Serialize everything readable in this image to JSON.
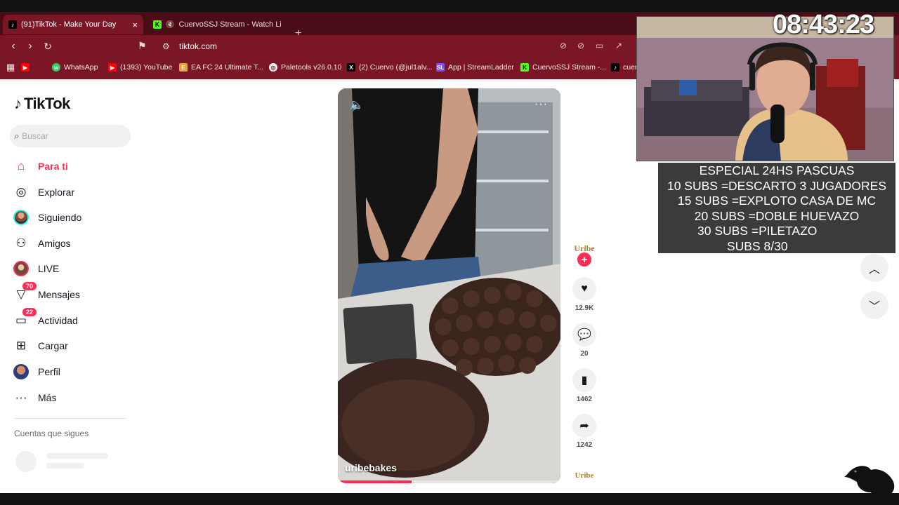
{
  "browser": {
    "tabs": [
      {
        "label": "(91)TikTok - Make Your Day",
        "active": true,
        "icon": "tiktok-icon"
      },
      {
        "label": "CuervoSSJ Stream - Watch Live o",
        "active": false,
        "icon": "kick-icon"
      }
    ],
    "new_tab": "+",
    "url": "tiktok.com",
    "bookmarks": [
      {
        "label": "WhatsApp",
        "icon": "whatsapp-icon",
        "color": "#25d366"
      },
      {
        "label": "(1393) YouTube",
        "icon": "youtube-icon",
        "color": "#ff0000"
      },
      {
        "label": "EA FC 24 Ultimate T...",
        "icon": "ea-icon",
        "color": "#e9a23b"
      },
      {
        "label": "Paletools v26.0.10",
        "icon": "globe-icon",
        "color": "#ffffff"
      },
      {
        "label": "(2) Cuervo (@jul1alv...",
        "icon": "x-icon",
        "color": "#000000"
      },
      {
        "label": "App | StreamLadder",
        "icon": "streamladder-icon",
        "color": "#7c4dff"
      },
      {
        "label": "CuervoSSJ Stream -...",
        "icon": "kick-icon",
        "color": "#53fc18"
      },
      {
        "label": "cuer",
        "icon": "tiktok-icon",
        "color": "#000000"
      }
    ]
  },
  "tiktok": {
    "logo_text": "TikTok",
    "search_placeholder": "Buscar",
    "nav": [
      {
        "label": "Para ti",
        "icon": "home-icon",
        "active": true
      },
      {
        "label": "Explorar",
        "icon": "compass-icon"
      },
      {
        "label": "Siguiendo",
        "icon": "following-avatar-icon"
      },
      {
        "label": "Amigos",
        "icon": "friends-icon"
      },
      {
        "label": "LIVE",
        "icon": "live-avatar-icon"
      },
      {
        "label": "Mensajes",
        "icon": "messages-icon",
        "badge": "70"
      },
      {
        "label": "Actividad",
        "icon": "activity-icon",
        "badge": "22"
      },
      {
        "label": "Cargar",
        "icon": "upload-icon"
      },
      {
        "label": "Perfil",
        "icon": "profile-avatar-icon"
      },
      {
        "label": "Más",
        "icon": "more-icon"
      }
    ],
    "following_title": "Cuentas que sigues",
    "video": {
      "author": "uribebakes",
      "progress": 0.33,
      "creator_logo": "Uribe"
    },
    "actions": {
      "likes": "12.9K",
      "comments": "20",
      "saves": "1462",
      "shares": "1242"
    }
  },
  "stream": {
    "clock": "08:43:23",
    "goals": [
      "ESPECIAL 24HS PASCUAS",
      "10 SUBS =DESCARTO 3 JUGADORES",
      "15 SUBS =EXPLOTO CASA DE MC",
      "20 SUBS =DOBLE HUEVAZO",
      "30 SUBS =PILETAZO",
      "SUBS 8/30"
    ]
  },
  "colors": {
    "accent": "#fe2c55",
    "browser_frame": "#7a1626",
    "tabbar": "#4a0c17"
  }
}
